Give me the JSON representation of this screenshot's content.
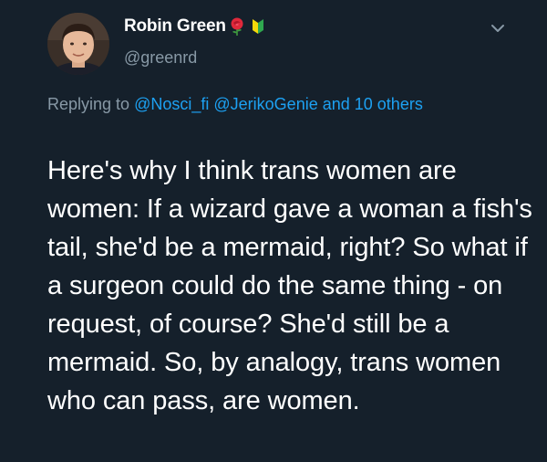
{
  "tweet": {
    "author": {
      "display_name": "Robin Green",
      "handle": "@greenrd",
      "name_icons": [
        "rose-icon",
        "beginner-symbol-icon"
      ]
    },
    "reply": {
      "prefix": "Replying to",
      "mention_1": "@Nosci_fi",
      "mention_2": "@JerikoGenie",
      "suffix": "and 10 others"
    },
    "text": "Here's why I think trans women are women: If a wizard gave a woman a fish's tail, she'd be a mermaid, right? So what if a surgeon could do the same thing - on request, of course? She'd still be a mermaid. So, by analogy, trans women who can pass, are women.",
    "menu_icon": "chevron-down-icon"
  },
  "colors": {
    "background": "#15202b",
    "primary_text": "#ffffff",
    "secondary_text": "#8899a6",
    "accent": "#1da1f2"
  }
}
